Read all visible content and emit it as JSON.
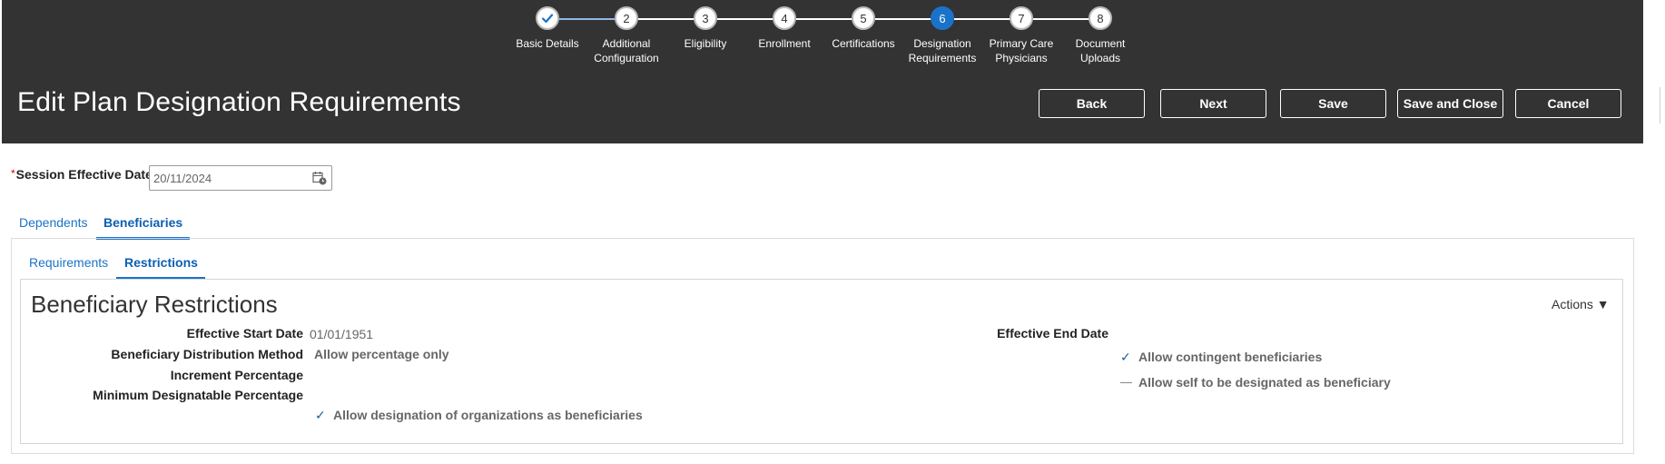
{
  "train": {
    "steps": [
      {
        "number": "✓",
        "label": "Basic Details",
        "state": "done"
      },
      {
        "number": "2",
        "label": "Additional\nConfiguration",
        "state": "todo"
      },
      {
        "number": "3",
        "label": "Eligibility",
        "state": "todo"
      },
      {
        "number": "4",
        "label": "Enrollment",
        "state": "todo"
      },
      {
        "number": "5",
        "label": "Certifications",
        "state": "todo"
      },
      {
        "number": "6",
        "label": "Designation\nRequirements",
        "state": "current"
      },
      {
        "number": "7",
        "label": "Primary Care\nPhysicians",
        "state": "todo"
      },
      {
        "number": "8",
        "label": "Document\nUploads",
        "state": "todo"
      }
    ]
  },
  "header": {
    "title": "Edit Plan Designation Requirements",
    "buttons": {
      "back": "Back",
      "next": "Next",
      "save": "Save",
      "save_close": "Save and Close",
      "cancel": "Cancel"
    }
  },
  "session": {
    "required_mark": "*",
    "label": "Session Effective Date",
    "value": "20/11/2024"
  },
  "tabs": {
    "dependents": "Dependents",
    "beneficiaries": "Beneficiaries"
  },
  "subtabs": {
    "requirements": "Requirements",
    "restrictions": "Restrictions"
  },
  "section": {
    "title": "Beneficiary Restrictions",
    "actions": "Actions ▼"
  },
  "fields": {
    "effective_start_date_label": "Effective Start Date",
    "effective_start_date_value": "01/01/1951",
    "distribution_method_label": "Beneficiary Distribution Method",
    "distribution_method_value": "Allow percentage only",
    "increment_percentage_label": "Increment Percentage",
    "minimum_percentage_label": "Minimum Designatable Percentage",
    "effective_end_date_label": "Effective End Date"
  },
  "checkboxes": {
    "allow_organizations": "Allow designation of organizations as beneficiaries",
    "allow_contingent": "Allow contingent beneficiaries",
    "allow_self": "Allow self to be designated as beneficiary"
  },
  "colors": {
    "header_bg": "#333333",
    "accent": "#1a73c9"
  }
}
